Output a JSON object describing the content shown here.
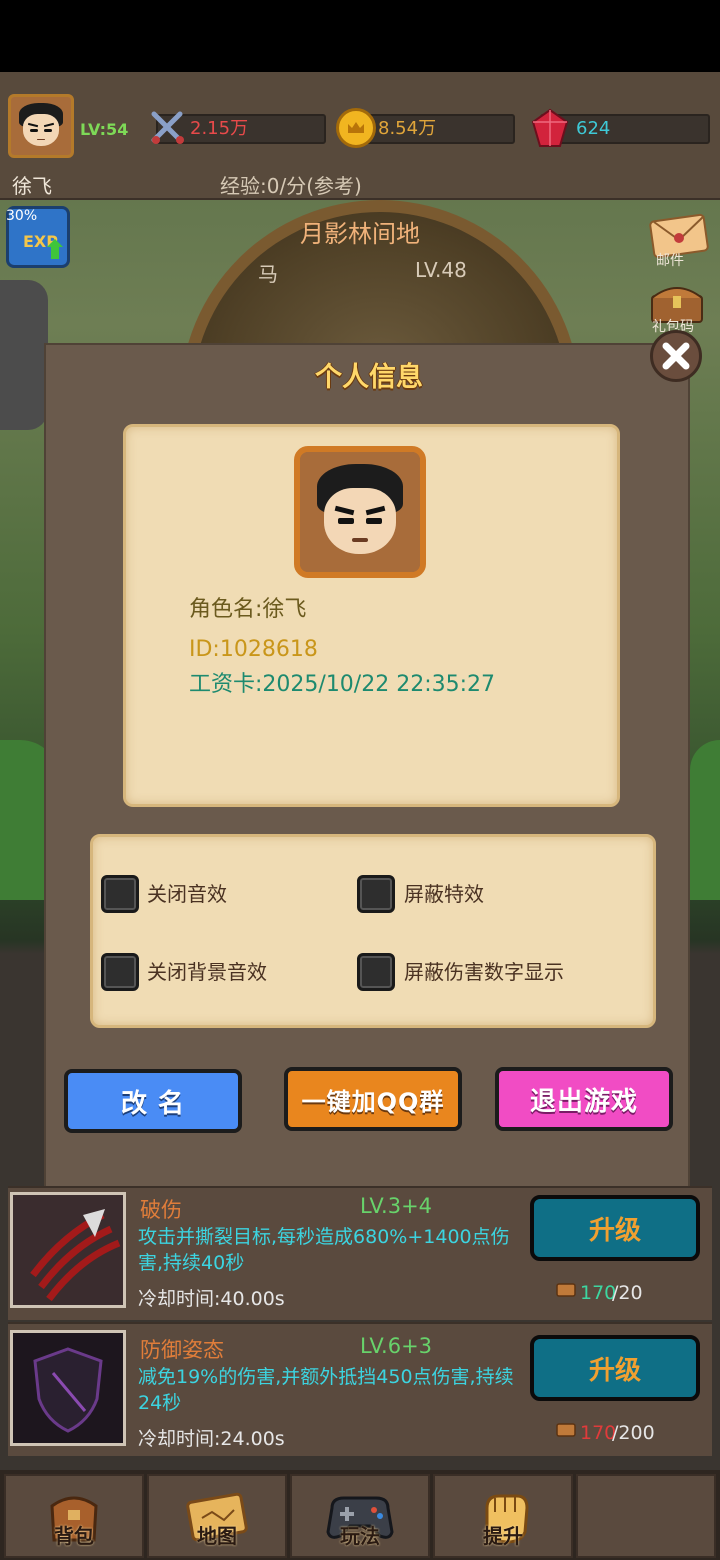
{
  "hud": {
    "player_level": "LV:54",
    "player_name": "徐飞",
    "power": "2.15万",
    "gold": "8.54万",
    "gems": "624",
    "exp_rate": "经验:0/分(参考)",
    "exp_boost_percent": "30%"
  },
  "scene": {
    "map_name": "月影林间地",
    "target_name": "马",
    "target_level": "LV.48"
  },
  "side_icons": {
    "mail_label": "邮件",
    "gift_code_label": "礼包码"
  },
  "modal": {
    "title": "个人信息",
    "role_name": "角色名:徐飞",
    "id": "ID:1028618",
    "salary_card": "工资卡:2025/10/22 22:35:27",
    "settings": [
      {
        "label": "关闭音效",
        "checked": false
      },
      {
        "label": "屏蔽特效",
        "checked": false
      },
      {
        "label": "关闭背景音效",
        "checked": false
      },
      {
        "label": "屏蔽伤害数字显示",
        "checked": false
      }
    ],
    "rename_label": "改 名",
    "qq_label": "一键加QQ群",
    "quit_label": "退出游戏"
  },
  "skills": [
    {
      "name": "破伤",
      "level": "LV.3+4",
      "desc": "攻击并撕裂目标,每秒造成680%+1400点伤害,持续40秒",
      "cooldown": "冷却时间:40.00s",
      "button": "升级",
      "cost_have": "170",
      "cost_need": "/20"
    },
    {
      "name": "防御姿态",
      "level": "LV.6+3",
      "desc": "减免19%的伤害,并额外抵挡450点伤害,持续24秒",
      "cooldown": "冷却时间:24.00s",
      "button": "升级",
      "cost_have": "170",
      "cost_need": "/200"
    }
  ],
  "nav": {
    "bag": "背包",
    "map": "地图",
    "gameplay": "玩法",
    "upgrade": "提升"
  },
  "colors": {
    "title_gold": "#ffd86a",
    "rename_btn": "#4a8cf5",
    "qq_btn": "#e9861e",
    "quit_btn": "#f14cc4",
    "upgrade_btn": "#0f6f86"
  }
}
